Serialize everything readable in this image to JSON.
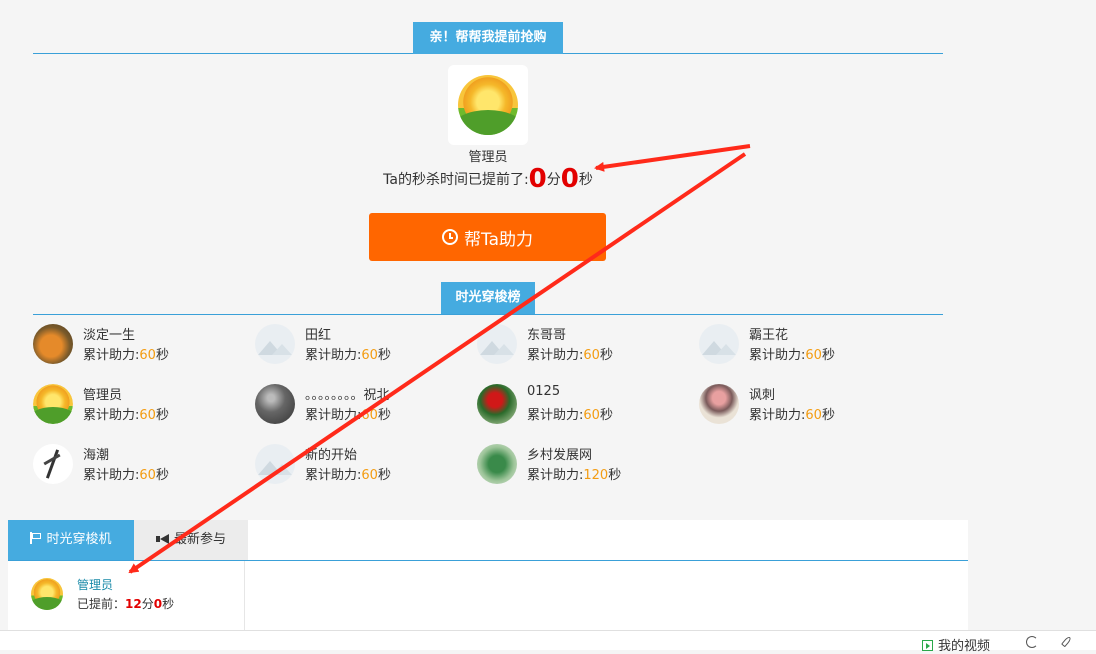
{
  "header": {
    "title": "亲！帮帮我提前抢购"
  },
  "owner": {
    "name": "管理员",
    "time_prefix": "Ta的秒杀时间已提前了:",
    "minutes": "0",
    "min_unit": "分",
    "seconds": "0",
    "sec_unit": "秒"
  },
  "help_button": {
    "label": "帮Ta助力",
    "icon": "clock-icon"
  },
  "ranking": {
    "title": "时光穿梭榜",
    "label_prefix": "累计助力:",
    "unit": "秒",
    "accent_color": "#f39c12",
    "items": [
      {
        "name": "淡定一生",
        "value": "60"
      },
      {
        "name": "田红",
        "value": "60"
      },
      {
        "name": "东哥哥",
        "value": "60"
      },
      {
        "name": "霸王花",
        "value": "60"
      },
      {
        "name": "管理员",
        "value": "60"
      },
      {
        "name": "。。。。。。。。祝北",
        "value": "60"
      },
      {
        "name": "0125",
        "value": "60"
      },
      {
        "name": "讽刺",
        "value": "60"
      },
      {
        "name": "海潮",
        "value": "60"
      },
      {
        "name": "新的开始",
        "value": "60"
      },
      {
        "name": "乡村发展网",
        "value": "120"
      }
    ]
  },
  "tabs": {
    "items": [
      {
        "label": "时光穿梭机",
        "icon": "flag-icon",
        "active": true
      },
      {
        "label": "最新参与",
        "icon": "megaphone-icon",
        "active": false
      }
    ]
  },
  "entry": {
    "name": "管理员",
    "prefix": "已提前：",
    "minutes": "12",
    "min_unit": "分",
    "seconds": "0",
    "sec_unit": "秒"
  },
  "bottom_bar": {
    "video_label": "我的视频"
  },
  "colors": {
    "accent_blue": "#45abe0",
    "button_orange": "#ff6600",
    "highlight_red": "#e20000",
    "arrow_red": "#ff2a1a"
  }
}
